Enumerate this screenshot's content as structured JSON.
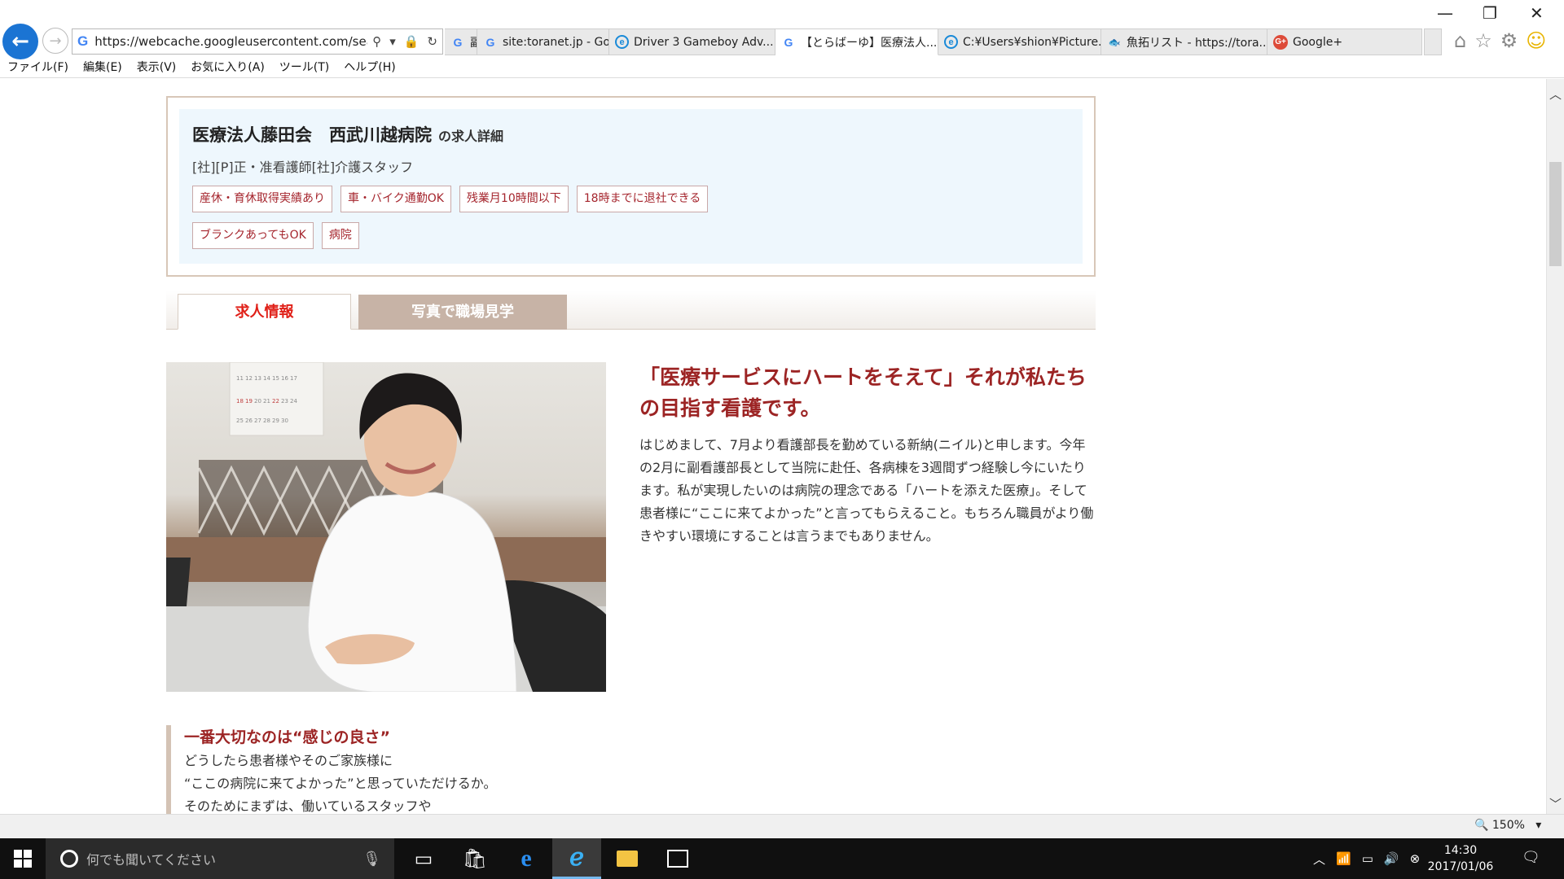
{
  "browser": {
    "url": "https://webcache.googleusercontent.com/search",
    "tabs": [
      {
        "label": "副",
        "icon": "google-icon",
        "active": false
      },
      {
        "label": "site:toranet.jp - Go...",
        "icon": "google-icon",
        "active": false
      },
      {
        "label": "Driver 3 Gameboy Adv...",
        "icon": "ie-icon",
        "active": false
      },
      {
        "label": "【とらばーゆ】医療法人...",
        "icon": "google-icon",
        "active": true
      },
      {
        "label": "C:¥Users¥shion¥Picture...",
        "icon": "ie-icon",
        "active": false
      },
      {
        "label": "魚拓リスト - https://tora...",
        "icon": "fish-icon",
        "active": false
      },
      {
        "label": "Google+",
        "icon": "google-plus-icon",
        "active": false
      }
    ],
    "menu": [
      "ファイル(F)",
      "編集(E)",
      "表示(V)",
      "お気に入り(A)",
      "ツール(T)",
      "ヘルプ(H)"
    ],
    "zoom": "150%"
  },
  "page": {
    "org_name": "医療法人藤田会　西武川越病院",
    "org_suffix": "の求人詳細",
    "job_kinds": "[社][P]正・准看護師[社]介護スタッフ",
    "tags": [
      "産休・育休取得実績あり",
      "車・バイク通勤OK",
      "残業月10時間以下",
      "18時までに退社できる",
      "ブランクあってもOK",
      "病院"
    ],
    "tabs": {
      "info": "求人情報",
      "photos": "写真で職場見学"
    },
    "headline": "「医療サービスにハートをそえて」それが私たちの目指す看護です。",
    "body": "はじめまして、7月より看護部長を勤めている新納(ニイル)と申します。今年の2月に副看護部長として当院に赴任、各病棟を3週間ずつ経験し今にいたります。私が実現したいのは病院の理念である「ハートを添えた医療」。そして患者様に“ここに来てよかった”と言ってもらえること。もちろん職員がより働きやすい環境にすることは言うまでもありません。",
    "section2": {
      "title": "一番大切なのは“感じの良さ”",
      "lines": [
        "どうしたら患者様やそのご家族様に",
        "“ここの病院に来てよかった”と思っていただけるか。",
        "そのためにまずは、働いているスタッフや"
      ]
    },
    "calendar_numbers": [
      "11",
      "12",
      "13",
      "14",
      "15",
      "16",
      "17",
      "18",
      "19",
      "20",
      "21",
      "22",
      "23",
      "24",
      "25",
      "26",
      "27",
      "28",
      "29",
      "30"
    ]
  },
  "taskbar": {
    "search_placeholder": "何でも聞いてください",
    "time": "14:30",
    "date": "2017/01/06"
  }
}
